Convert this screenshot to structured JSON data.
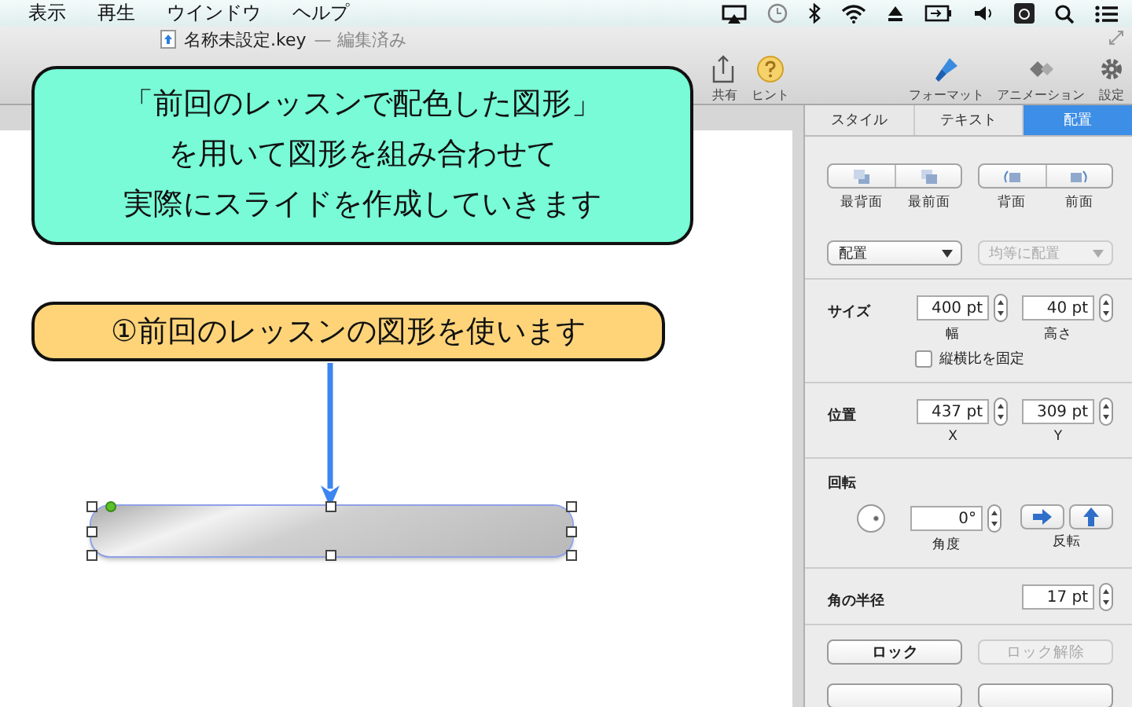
{
  "menu_bar": {
    "menus": [
      "表示",
      "再生",
      "ウインドウ",
      "ヘルプ"
    ]
  },
  "window": {
    "title": "名称未設定.key",
    "edited_note": "— 編集済み"
  },
  "toolbar": {
    "left": [
      {
        "label": "共有"
      },
      {
        "label": "ヒント"
      }
    ],
    "right": [
      {
        "label": "フォーマット"
      },
      {
        "label": "アニメーション"
      },
      {
        "label": "設定"
      }
    ]
  },
  "callouts": [
    {
      "kind": "note",
      "lines": [
        "「前回のレッスンで配色した図形」",
        "を用いて図形を組み合わせて",
        "実際にスライドを作成していきます"
      ]
    },
    {
      "kind": "step",
      "text": "①前回のレッスンの図形を使います"
    }
  ],
  "shape": {
    "selected": true
  },
  "inspector": {
    "tabs": [
      {
        "label": "スタイル",
        "selected": false
      },
      {
        "label": "テキスト",
        "selected": false
      },
      {
        "label": "配置",
        "selected": true
      }
    ],
    "arrange_groups": [
      [
        {
          "label": "最背面"
        },
        {
          "label": "最前面"
        }
      ],
      [
        {
          "label": "背面"
        },
        {
          "label": "前面"
        }
      ]
    ],
    "dropdowns": [
      {
        "value": "配置",
        "disabled": false
      },
      {
        "value": "均等に配置",
        "disabled": true
      }
    ],
    "size": {
      "label": "サイズ",
      "fields": [
        {
          "value": "400 pt",
          "caption": "幅"
        },
        {
          "value": "40 pt",
          "caption": "高さ"
        }
      ],
      "checkbox": {
        "label": "縦横比を固定",
        "checked": false
      }
    },
    "position": {
      "label": "位置",
      "fields": [
        {
          "value": "437 pt",
          "caption": "X"
        },
        {
          "value": "309 pt",
          "caption": "Y"
        }
      ]
    },
    "rotation": {
      "label": "回転",
      "angle": {
        "value": "0°",
        "caption": "角度"
      },
      "flip_caption": "反転"
    },
    "corner_radius": {
      "label": "角の半径",
      "value": "17 pt"
    },
    "lock_buttons": [
      {
        "label": "ロック",
        "disabled": false
      },
      {
        "label": "ロック解除",
        "disabled": true
      }
    ]
  }
}
